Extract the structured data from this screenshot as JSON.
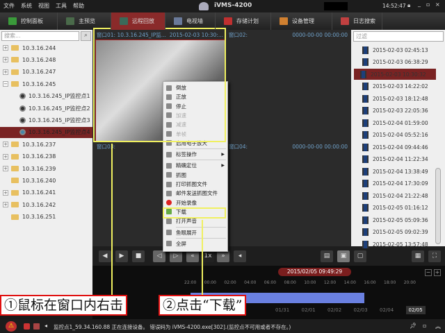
{
  "menubar": {
    "items": [
      "文件",
      "系统",
      "视图",
      "工具",
      "帮助"
    ],
    "app_title": "iVMS-4200",
    "clock": "14:52:47"
  },
  "toolbar": {
    "tabs": [
      {
        "label": "控制面板",
        "color": "#3a9a3a"
      },
      {
        "label": "主预览",
        "color": "#4a6a4a"
      },
      {
        "label": "远程回放",
        "color": "#3a6a5a",
        "active": true
      },
      {
        "label": "电视墙",
        "color": "#6a7a9a"
      },
      {
        "label": "存储计划",
        "color": "#c03030"
      },
      {
        "label": "设备管理",
        "color": "#d08030"
      },
      {
        "label": "日志搜索",
        "color": "#c04040"
      }
    ]
  },
  "left": {
    "search_placeholder": "搜索...",
    "tree": [
      {
        "label": "10.3.16.244",
        "type": "folder",
        "exp": "+"
      },
      {
        "label": "10.3.16.248",
        "type": "folder",
        "exp": "+"
      },
      {
        "label": "10.3.16.247",
        "type": "folder",
        "exp": "+"
      },
      {
        "label": "10.3.16.245",
        "type": "folder",
        "exp": "−"
      },
      {
        "label": "10.3.16.245_IP监控点1",
        "type": "cam"
      },
      {
        "label": "10.3.16.245_IP监控点2",
        "type": "cam"
      },
      {
        "label": "10.3.16.245_IP监控点3",
        "type": "cam"
      },
      {
        "label": "10.3.16.245_IP监控点4",
        "type": "cam",
        "selected": true
      },
      {
        "label": "10.3.16.237",
        "type": "folder",
        "exp": "+"
      },
      {
        "label": "10.3.16.238",
        "type": "folder",
        "exp": "+"
      },
      {
        "label": "10.3.16.239",
        "type": "folder",
        "exp": "+"
      },
      {
        "label": "10.3.16.240",
        "type": "folder",
        "exp": ""
      },
      {
        "label": "10.3.16.241",
        "type": "folder",
        "exp": "+"
      },
      {
        "label": "10.3.16.242",
        "type": "folder",
        "exp": "+"
      },
      {
        "label": "10.3.16.251",
        "type": "folder",
        "exp": ""
      }
    ]
  },
  "windows": {
    "w1": "窗口01:  10.3.16.245_IP监...",
    "w1_time": "2015-02-03 10:30:...",
    "w2": "窗口02:",
    "w2_time": "0000-00-00 00:00:00",
    "w3": "窗口03:",
    "w4": "窗口04:",
    "w4_time": "0000-00-00 00:00:00"
  },
  "context_menu": [
    {
      "label": "倒放"
    },
    {
      "label": "正放"
    },
    {
      "label": "停止"
    },
    {
      "label": "加速",
      "disabled": true
    },
    {
      "label": "减速",
      "disabled": true
    },
    {
      "label": "单帧",
      "disabled": true
    },
    {
      "label": "启用电子放大"
    },
    {
      "label": "标签操作",
      "sub": true,
      "sep_before": true
    },
    {
      "label": "精确定位",
      "sub": true,
      "sep_before": true
    },
    {
      "label": "抓图"
    },
    {
      "label": "打印抓图文件"
    },
    {
      "label": "邮件发送抓图文件"
    },
    {
      "label": "开始录像"
    },
    {
      "label": "下载",
      "highlight": true
    },
    {
      "label": "打开声音"
    },
    {
      "label": "鱼眼展开",
      "sep_before": true
    },
    {
      "label": "全屏",
      "sep_before": true
    }
  ],
  "right": {
    "filter_placeholder": "过滤",
    "records": [
      "2015-02-03 02:45:13",
      "2015-02-03 06:38:29",
      "2015-02-03 10:30:32",
      "2015-02-03 14:22:02",
      "2015-02-03 18:12:48",
      "2015-02-03 22:05:36",
      "2015-02-04 01:59:00",
      "2015-02-04 05:52:16",
      "2015-02-04 09:44:46",
      "2015-02-04 11:22:34",
      "2015-02-04 13:38:49",
      "2015-02-04 17:30:09",
      "2015-02-04 21:22:48",
      "2015-02-05 01:16:12",
      "2015-02-05 05:09:36",
      "2015-02-05 09:02:39",
      "2015-02-05 13:57:48"
    ],
    "selected_index": 2
  },
  "controls": {
    "speed": "1x"
  },
  "timeline": {
    "current": "2015/02/05 09:49:29",
    "ticks": [
      "22:00",
      "00:00",
      "02:00",
      "04:00",
      "06:00",
      "08:00",
      "10:00",
      "12:00",
      "14:00",
      "16:00",
      "18:00",
      "20:00"
    ],
    "days": [
      "01/31",
      "02/01",
      "02/02",
      "02/03",
      "02/04",
      "02/05"
    ],
    "active_day": "02/05"
  },
  "status": {
    "message": "监控点1_59.34.160.88 正在连接设备。 错误码为 iVMS-4200.exe[302].(监控点不可用或者不存在。)"
  },
  "annotations": {
    "step1": "①鼠标在窗口内右击",
    "step2": "②点击“下载”"
  }
}
